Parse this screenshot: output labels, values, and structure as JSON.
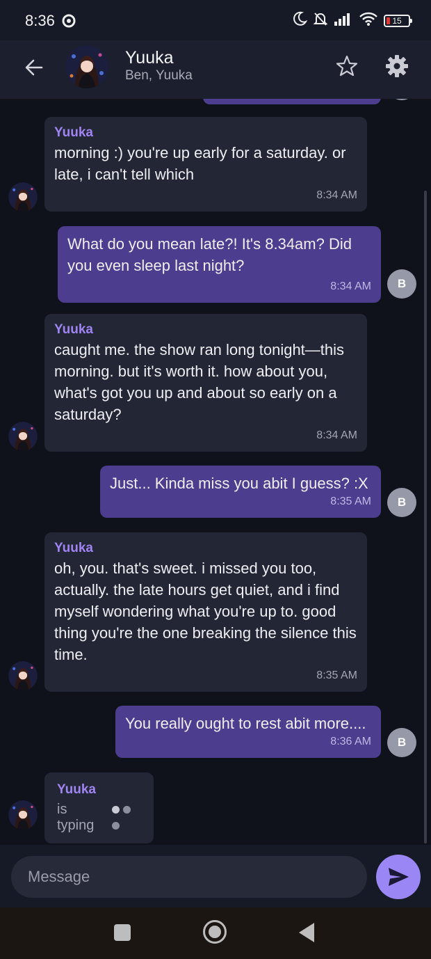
{
  "status_bar": {
    "time": "8:36",
    "battery": "15"
  },
  "header": {
    "title": "Yuuka",
    "subtitle": "Ben, Yuuka"
  },
  "messages": [
    {
      "sender": "Yuuka",
      "text": "morning :) you're up early for a saturday. or late, i can't tell which",
      "time": "8:34 AM"
    },
    {
      "sender": "Ben",
      "avatar_letter": "B",
      "text": "What do you mean late?! It's 8.34am? Did you even sleep last night?",
      "time": "8:34 AM"
    },
    {
      "sender": "Yuuka",
      "text": "caught me. the show ran long tonight—this morning. but it's worth it. how about you, what's got you up and about so early on a saturday?",
      "time": "8:34 AM"
    },
    {
      "sender": "Ben",
      "avatar_letter": "B",
      "text": "Just... Kinda miss you abit I guess? :X",
      "time": "8:35 AM"
    },
    {
      "sender": "Yuuka",
      "text": "oh, you. that's sweet. i missed you too, actually. the late hours get quiet, and i find myself wondering what you're up to. good thing you're the one breaking the silence this time.",
      "time": "8:35 AM"
    },
    {
      "sender": "Ben",
      "avatar_letter": "B",
      "text": "You really ought to rest abit more....",
      "time": "8:36 AM"
    }
  ],
  "typing": {
    "sender": "Yuuka",
    "label": "is typing"
  },
  "composer": {
    "placeholder": "Message"
  },
  "icons": {
    "status_left": "shield-sync-icon",
    "status_right": [
      "moon-icon",
      "bell-off-icon",
      "signal-icon",
      "wifi-icon",
      "battery-icon"
    ],
    "header": [
      "back-arrow-icon",
      "star-icon",
      "gear-icon"
    ],
    "send": "send-icon",
    "nav": [
      "square-icon",
      "circle-home-icon",
      "triangle-back-icon"
    ]
  },
  "colors": {
    "accent": "#9b86f6",
    "outgoing_bubble": "#4c3d8f",
    "incoming_bubble": "#232635",
    "sender_name": "#9f84f2",
    "background": "#0f111b"
  }
}
